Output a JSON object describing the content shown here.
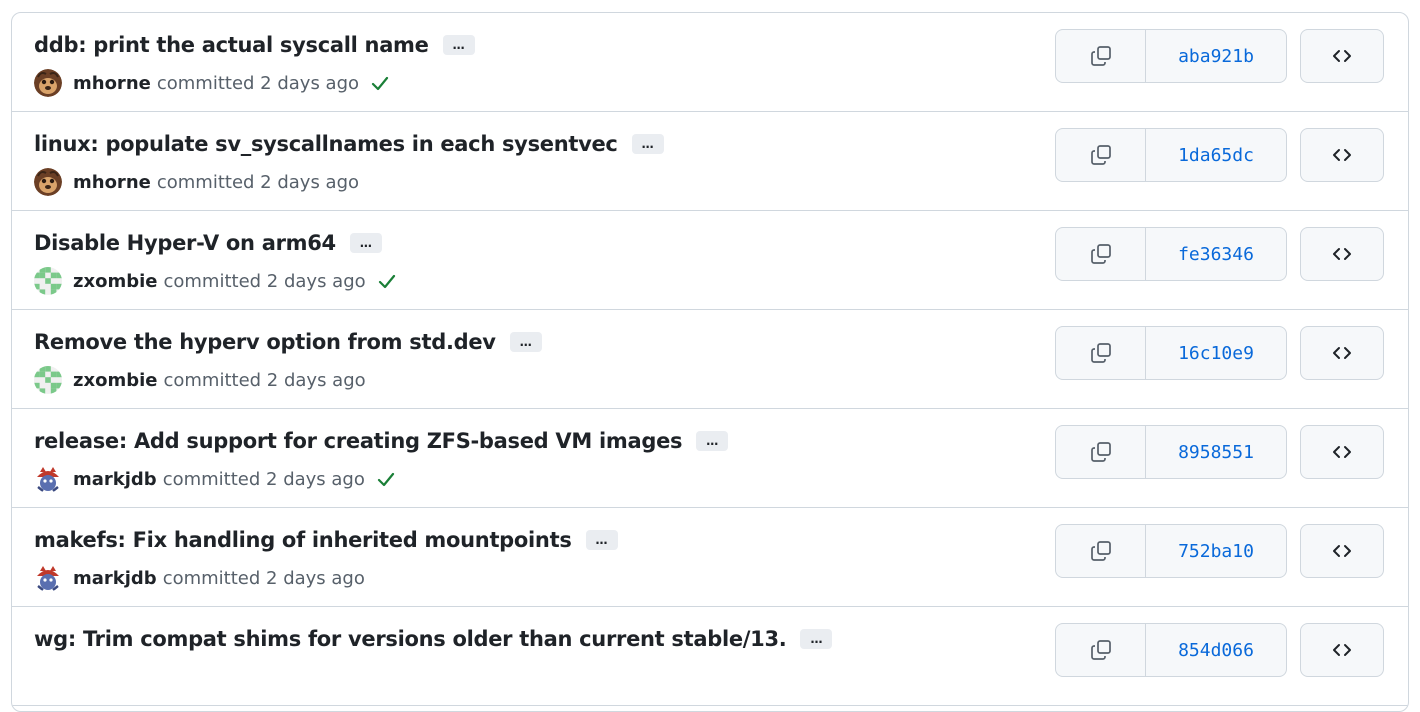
{
  "commits": [
    {
      "title": "ddb: print the actual syscall name",
      "author": "mhorne",
      "meta": "committed 2 days ago",
      "checked": true,
      "sha": "aba921b",
      "avatar": "avatar-mhorne"
    },
    {
      "title": "linux: populate sv_syscallnames in each sysentvec",
      "author": "mhorne",
      "meta": "committed 2 days ago",
      "checked": false,
      "sha": "1da65dc",
      "avatar": "avatar-mhorne"
    },
    {
      "title": "Disable Hyper-V on arm64",
      "author": "zxombie",
      "meta": "committed 2 days ago",
      "checked": true,
      "sha": "fe36346",
      "avatar": "avatar-zxombie"
    },
    {
      "title": "Remove the hyperv option from std.dev",
      "author": "zxombie",
      "meta": "committed 2 days ago",
      "checked": false,
      "sha": "16c10e9",
      "avatar": "avatar-zxombie"
    },
    {
      "title": "release: Add support for creating ZFS-based VM images",
      "author": "markjdb",
      "meta": "committed 2 days ago",
      "checked": true,
      "sha": "8958551",
      "avatar": "avatar-markjdb"
    },
    {
      "title": "makefs: Fix handling of inherited mountpoints",
      "author": "markjdb",
      "meta": "committed 2 days ago",
      "checked": false,
      "sha": "752ba10",
      "avatar": "avatar-markjdb"
    },
    {
      "title": "wg: Trim compat shims for versions older than current stable/13.",
      "author": "",
      "meta": "",
      "checked": false,
      "sha": "854d066",
      "avatar": ""
    }
  ],
  "ellipsis_label": "…",
  "icons": {
    "copy": "copy-icon",
    "check": "check-icon",
    "browse": "code-icon"
  },
  "colors": {
    "sha_link": "#0969da",
    "check": "#1a7f37",
    "border": "#d0d7de",
    "button_bg": "#f6f8fa"
  }
}
